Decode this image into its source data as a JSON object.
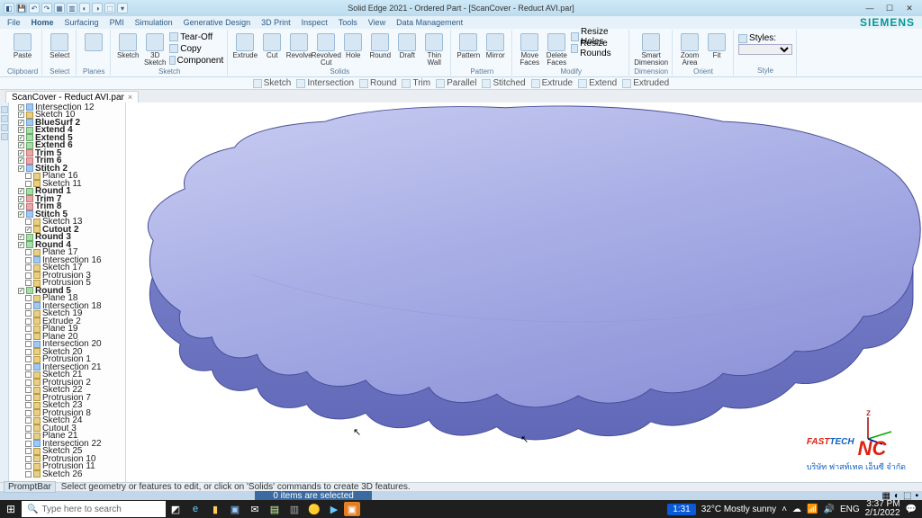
{
  "app": {
    "title": "Solid Edge 2021 - Ordered Part - [ScanCover - Reduct AVI.par]",
    "brand": "SIEMENS"
  },
  "menu": {
    "items": [
      "File",
      "Home",
      "Surfacing",
      "PMI",
      "Simulation",
      "Generative Design",
      "3D Print",
      "Inspect",
      "Tools",
      "View",
      "Data Management"
    ]
  },
  "ribbon": {
    "groups": [
      {
        "label": "Clipboard",
        "buttons": [
          {
            "label": "Paste"
          }
        ]
      },
      {
        "label": "Select",
        "buttons": [
          {
            "label": "Select"
          }
        ]
      },
      {
        "label": "Planes",
        "buttons": [
          {
            "label": ""
          }
        ]
      },
      {
        "label": "Sketch",
        "buttons": [
          {
            "label": "Sketch"
          },
          {
            "label": "3D Sketch"
          }
        ],
        "small": [
          {
            "label": "Tear-Off"
          },
          {
            "label": "Copy"
          },
          {
            "label": "Component"
          }
        ]
      },
      {
        "label": "Solids",
        "buttons": [
          {
            "label": "Extrude"
          },
          {
            "label": "Cut"
          },
          {
            "label": "Revolve"
          },
          {
            "label": "Revolved Cut"
          },
          {
            "label": "Hole"
          },
          {
            "label": "Round"
          },
          {
            "label": "Draft"
          },
          {
            "label": "Thin Wall"
          }
        ]
      },
      {
        "label": "Pattern",
        "buttons": [
          {
            "label": "Pattern"
          },
          {
            "label": "Mirror"
          }
        ]
      },
      {
        "label": "Modify",
        "buttons": [
          {
            "label": "Move Faces"
          },
          {
            "label": "Delete Faces"
          }
        ],
        "small": [
          {
            "label": "Resize Holes"
          },
          {
            "label": "Resize Rounds"
          }
        ]
      },
      {
        "label": "Dimension",
        "buttons": [
          {
            "label": "Smart Dimension"
          }
        ]
      },
      {
        "label": "Orient",
        "buttons": [
          {
            "label": "Zoom Area"
          },
          {
            "label": "Fit"
          }
        ]
      },
      {
        "label": "Style",
        "styles": true,
        "styles_label": "Styles:"
      }
    ]
  },
  "subtoolbar": [
    "Sketch",
    "Intersection",
    "Round",
    "Trim",
    "Parallel",
    "Stitched",
    "Extrude",
    "Extend",
    "Extruded"
  ],
  "doctab": {
    "label": "ScanCover - Reduct AVI.par"
  },
  "tree": [
    {
      "t": "Intersection 12",
      "c": true,
      "i": "b",
      "d": 1
    },
    {
      "t": "Sketch 10",
      "c": true,
      "i": "",
      "d": 1
    },
    {
      "t": "BlueSurf 2",
      "c": true,
      "i": "b",
      "d": 1,
      "b": true
    },
    {
      "t": "Extend 4",
      "c": true,
      "i": "g",
      "d": 1,
      "b": true
    },
    {
      "t": "Extend 5",
      "c": true,
      "i": "g",
      "d": 1,
      "b": true
    },
    {
      "t": "Extend 6",
      "c": true,
      "i": "g",
      "d": 1,
      "b": true
    },
    {
      "t": "Trim 5",
      "c": true,
      "i": "r",
      "d": 1,
      "b": true
    },
    {
      "t": "Trim 6",
      "c": true,
      "i": "r",
      "d": 1,
      "b": true
    },
    {
      "t": "Stitch 2",
      "c": true,
      "i": "b",
      "d": 1,
      "b": true
    },
    {
      "t": "Plane 16",
      "c": false,
      "i": "",
      "d": 2
    },
    {
      "t": "Sketch 11",
      "c": false,
      "i": "",
      "d": 2
    },
    {
      "t": "Round 1",
      "c": true,
      "i": "g",
      "d": 1,
      "b": true
    },
    {
      "t": "Trim 7",
      "c": true,
      "i": "r",
      "d": 1,
      "b": true
    },
    {
      "t": "Trim 8",
      "c": true,
      "i": "r",
      "d": 1,
      "b": true
    },
    {
      "t": "Stitch 5",
      "c": true,
      "i": "b",
      "d": 1,
      "b": true
    },
    {
      "t": "Sketch 13",
      "c": false,
      "i": "",
      "d": 2
    },
    {
      "t": "Cutout 2",
      "c": true,
      "i": "",
      "d": 2,
      "b": true
    },
    {
      "t": "Round 3",
      "c": true,
      "i": "g",
      "d": 1,
      "b": true
    },
    {
      "t": "Round 4",
      "c": true,
      "i": "g",
      "d": 1,
      "b": true
    },
    {
      "t": "Plane 17",
      "c": false,
      "i": "",
      "d": 2
    },
    {
      "t": "Intersection 16",
      "c": false,
      "i": "b",
      "d": 2
    },
    {
      "t": "Sketch 17",
      "c": false,
      "i": "",
      "d": 2
    },
    {
      "t": "Protrusion 3",
      "c": false,
      "i": "",
      "d": 2
    },
    {
      "t": "Protrusion 5",
      "c": false,
      "i": "",
      "d": 2
    },
    {
      "t": "Round 5",
      "c": true,
      "i": "g",
      "d": 1,
      "b": true
    },
    {
      "t": "Plane 18",
      "c": false,
      "i": "",
      "d": 2
    },
    {
      "t": "Intersection 18",
      "c": false,
      "i": "b",
      "d": 2
    },
    {
      "t": "Sketch 19",
      "c": false,
      "i": "",
      "d": 2
    },
    {
      "t": "Extrude 2",
      "c": false,
      "i": "",
      "d": 2
    },
    {
      "t": "Plane 19",
      "c": false,
      "i": "",
      "d": 2
    },
    {
      "t": "Plane 20",
      "c": false,
      "i": "",
      "d": 2
    },
    {
      "t": "Intersection 20",
      "c": false,
      "i": "b",
      "d": 2
    },
    {
      "t": "Sketch 20",
      "c": false,
      "i": "",
      "d": 2
    },
    {
      "t": "Protrusion 1",
      "c": false,
      "i": "",
      "d": 2
    },
    {
      "t": "Intersection 21",
      "c": false,
      "i": "b",
      "d": 2
    },
    {
      "t": "Sketch 21",
      "c": false,
      "i": "",
      "d": 2
    },
    {
      "t": "Protrusion 2",
      "c": false,
      "i": "",
      "d": 2
    },
    {
      "t": "Sketch 22",
      "c": false,
      "i": "",
      "d": 2
    },
    {
      "t": "Protrusion 7",
      "c": false,
      "i": "",
      "d": 2
    },
    {
      "t": "Sketch 23",
      "c": false,
      "i": "",
      "d": 2
    },
    {
      "t": "Protrusion 8",
      "c": false,
      "i": "",
      "d": 2
    },
    {
      "t": "Sketch 24",
      "c": false,
      "i": "",
      "d": 2
    },
    {
      "t": "Cutout 3",
      "c": false,
      "i": "",
      "d": 2
    },
    {
      "t": "Plane 21",
      "c": false,
      "i": "",
      "d": 2
    },
    {
      "t": "Intersection 22",
      "c": false,
      "i": "b",
      "d": 2
    },
    {
      "t": "Sketch 25",
      "c": false,
      "i": "",
      "d": 2
    },
    {
      "t": "Protrusion 10",
      "c": false,
      "i": "",
      "d": 2
    },
    {
      "t": "Protrusion 11",
      "c": false,
      "i": "",
      "d": 2
    },
    {
      "t": "Sketch 26",
      "c": false,
      "i": "",
      "d": 2
    }
  ],
  "prompt": {
    "tag": "PromptBar",
    "msg": "Select geometry or features to edit, or click on 'Solids' commands to create 3D features."
  },
  "status": {
    "selection": "0 items are selected"
  },
  "logo": {
    "line1a": "FAST",
    "line1b": "TECH",
    "line1c": "NC",
    "line2": "บริษัท  ฟาสท์เทค  เอ็นซี  จำกัด"
  },
  "taskbar": {
    "search_placeholder": "Type here to search",
    "weather": "32°C  Mostly sunny",
    "lang": "ENG",
    "time": "3:37 PM",
    "time2": "1:31",
    "date": "2/1/2022"
  }
}
